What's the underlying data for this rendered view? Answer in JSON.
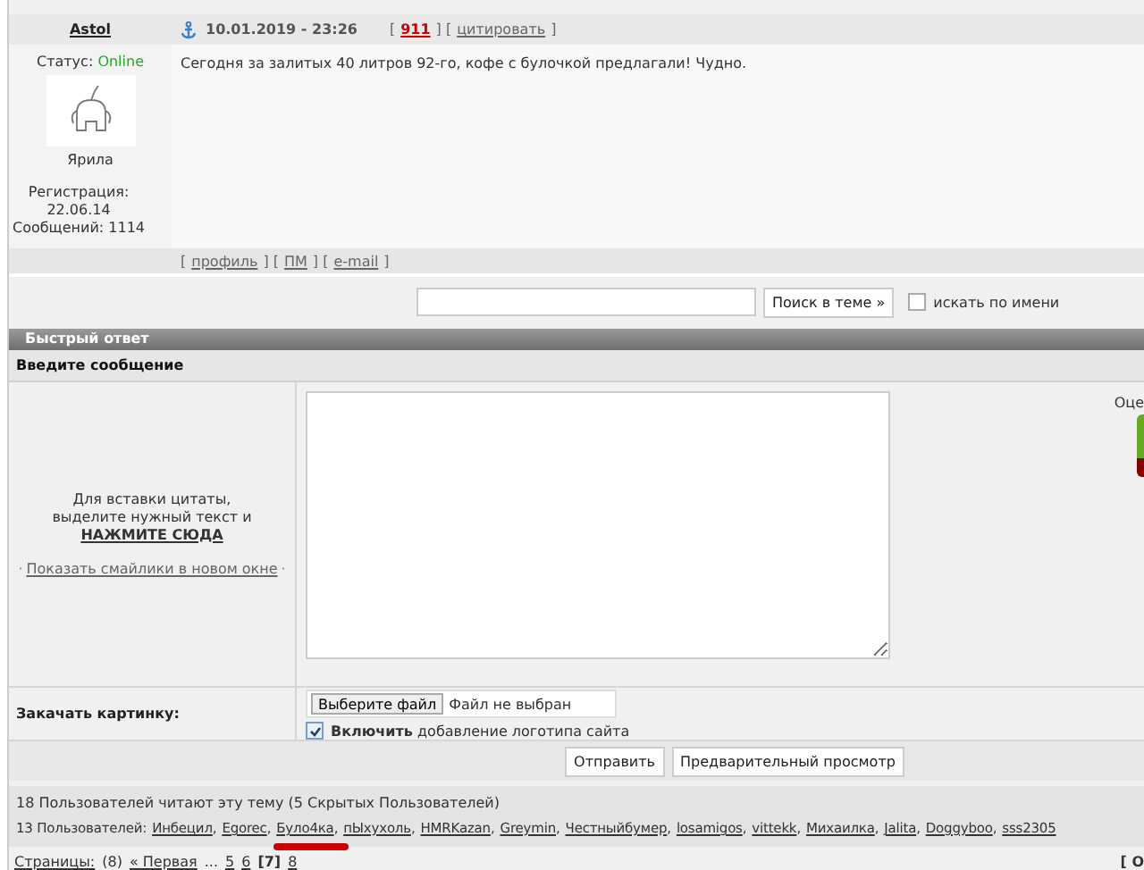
{
  "post": {
    "author": "Astol",
    "date": "10.01.2019 - 23:26",
    "header_links": [
      {
        "text": "[",
        "kind": "plain"
      },
      {
        "text": "911",
        "kind": "count"
      },
      {
        "text": "] [",
        "kind": "plain"
      },
      {
        "text": "цитировать",
        "kind": "link"
      },
      {
        "text": "]",
        "kind": "plain"
      }
    ],
    "status_label": "Статус:",
    "status": "Online",
    "rank": "Ярила",
    "registration_label": "Регистрация:",
    "registration_date": "22.06.14",
    "messages": "Сообщений: 1114",
    "text": "Сегодня за залитых 40 литров 92-го, кофе с булочкой предлагали! Чудно.",
    "footer_links": [
      {
        "text": "[",
        "kind": "plain"
      },
      {
        "text": "профиль",
        "kind": "link"
      },
      {
        "text": "] [",
        "kind": "plain"
      },
      {
        "text": "ПМ",
        "kind": "link"
      },
      {
        "text": "] [",
        "kind": "plain"
      },
      {
        "text": "e-mail",
        "kind": "link"
      },
      {
        "text": "]",
        "kind": "plain"
      }
    ]
  },
  "search": {
    "button": "Поиск в теме »",
    "by_name": {
      "label": "искать по имени",
      "checked": false
    }
  },
  "quick_reply": {
    "title": "Быстрый ответ",
    "message_label": "Введите сообщение",
    "quote_hint": "Для вставки цитаты, выделите нужный текст и",
    "quote_link": "НАЖМИТЕ СЮДА",
    "smilies_link": "Показать смайлики в новом окне",
    "bullet": "·",
    "rating_label": "Оце",
    "upload_label": "Закачать картинку:",
    "file_button": "Выберите файл",
    "file_status": "Файл не выбран",
    "logo": {
      "label": "**Включить** добавление логотипа сайта",
      "checked": true
    },
    "buttons": [
      "Отправить",
      "Предварительный просмотр"
    ]
  },
  "readers": {
    "summary": "18 Пользователей читают эту тему (5 Скрытых Пользователей)",
    "prefix": "13 Пользователей:",
    "separator": ",",
    "users": [
      "Инбецил",
      "Egorec",
      "Було4ка",
      "пЫхухоль",
      "HMRKazan",
      "Greymin",
      "Честныйбумер",
      "losamigos",
      "vittekk",
      "Михаилка",
      "Jalita",
      "Doggyboo",
      "sss2305"
    ]
  },
  "pagination": {
    "label": "Страницы:",
    "count": "(8)",
    "first": "« Первая",
    "ellipsis": "...",
    "pages": [
      {
        "label": "5",
        "selected": false
      },
      {
        "label": "6",
        "selected": false
      },
      {
        "label": "[7]",
        "selected": true
      },
      {
        "label": "8",
        "selected": false
      }
    ],
    "right_text": "[ О"
  }
}
